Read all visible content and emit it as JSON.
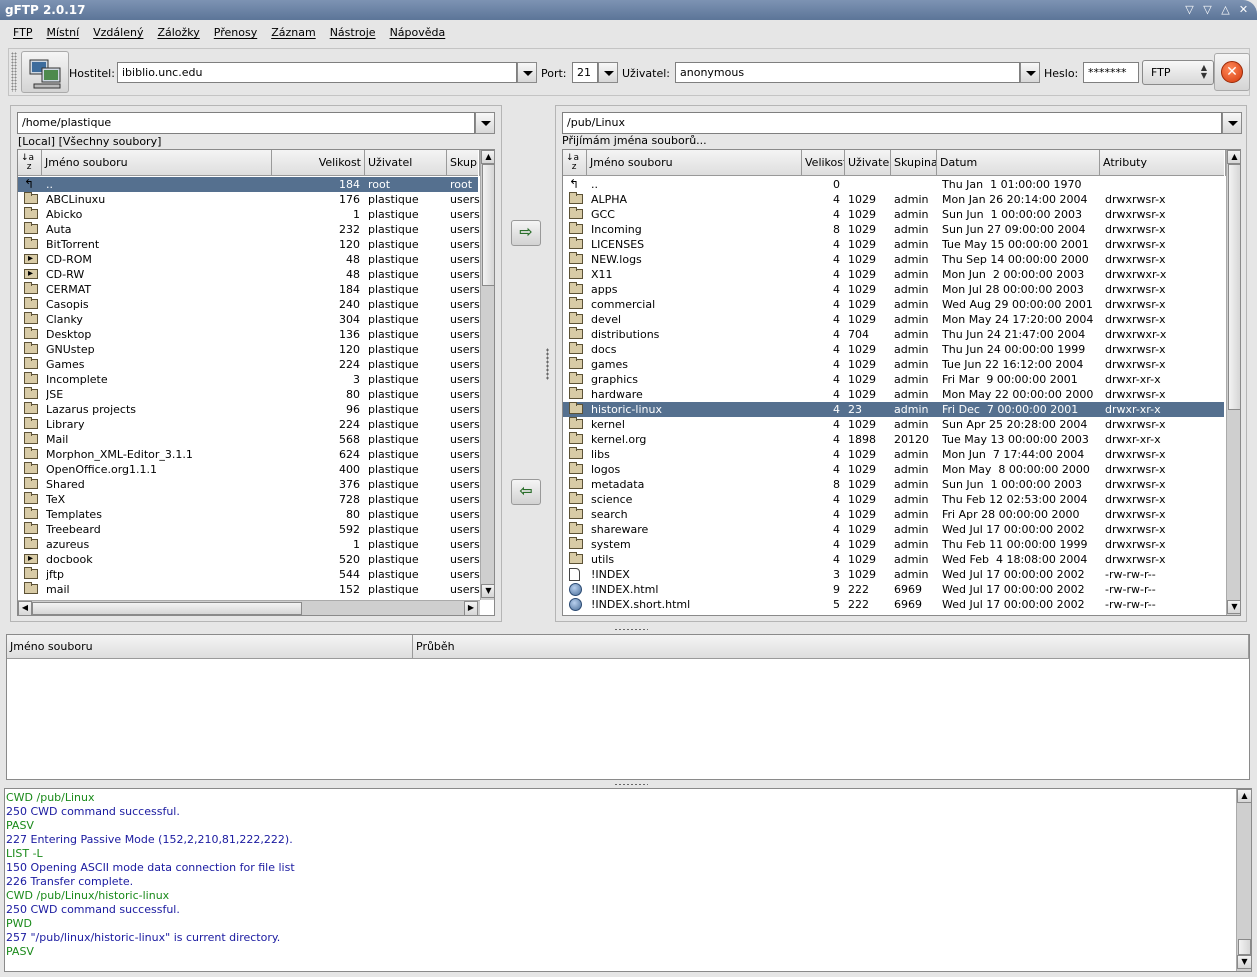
{
  "window": {
    "title": "gFTP 2.0.17"
  },
  "menu": [
    "FTP",
    "Místní",
    "Vzdálený",
    "Záložky",
    "Přenosy",
    "Záznam",
    "Nástroje",
    "Nápověda"
  ],
  "toolbar": {
    "host_label": "Hostitel:",
    "host_value": "ibiblio.unc.edu",
    "port_label": "Port:",
    "port_value": "21",
    "user_label": "Uživatel:",
    "user_value": "anonymous",
    "password_label": "Heslo:",
    "password_value": "*******",
    "protocol": "FTP"
  },
  "local": {
    "path": "/home/plastique",
    "status": "[Local] [Všechny soubory]",
    "columns": [
      "Jméno souboru",
      "Velikost",
      "Uživatel",
      "Skup"
    ],
    "files": [
      {
        "icon": "up",
        "name": "..",
        "size": "184",
        "user": "root",
        "group": "root",
        "selected": true
      },
      {
        "icon": "folder",
        "name": "ABCLinuxu",
        "size": "176",
        "user": "plastique",
        "group": "users"
      },
      {
        "icon": "folder",
        "name": "Abicko",
        "size": "1",
        "user": "plastique",
        "group": "users"
      },
      {
        "icon": "folder",
        "name": "Auta",
        "size": "232",
        "user": "plastique",
        "group": "users"
      },
      {
        "icon": "folder",
        "name": "BitTorrent",
        "size": "120",
        "user": "plastique",
        "group": "users"
      },
      {
        "icon": "link",
        "name": "CD-ROM",
        "size": "48",
        "user": "plastique",
        "group": "users"
      },
      {
        "icon": "link",
        "name": "CD-RW",
        "size": "48",
        "user": "plastique",
        "group": "users"
      },
      {
        "icon": "folder",
        "name": "CERMAT",
        "size": "184",
        "user": "plastique",
        "group": "users"
      },
      {
        "icon": "folder",
        "name": "Casopis",
        "size": "240",
        "user": "plastique",
        "group": "users"
      },
      {
        "icon": "folder",
        "name": "Clanky",
        "size": "304",
        "user": "plastique",
        "group": "users"
      },
      {
        "icon": "folder",
        "name": "Desktop",
        "size": "136",
        "user": "plastique",
        "group": "users"
      },
      {
        "icon": "folder",
        "name": "GNUstep",
        "size": "120",
        "user": "plastique",
        "group": "users"
      },
      {
        "icon": "folder",
        "name": "Games",
        "size": "224",
        "user": "plastique",
        "group": "users"
      },
      {
        "icon": "folder",
        "name": "Incomplete",
        "size": "3",
        "user": "plastique",
        "group": "users"
      },
      {
        "icon": "folder",
        "name": "JSE",
        "size": "80",
        "user": "plastique",
        "group": "users"
      },
      {
        "icon": "folder",
        "name": "Lazarus projects",
        "size": "96",
        "user": "plastique",
        "group": "users"
      },
      {
        "icon": "folder",
        "name": "Library",
        "size": "224",
        "user": "plastique",
        "group": "users"
      },
      {
        "icon": "folder",
        "name": "Mail",
        "size": "568",
        "user": "plastique",
        "group": "users"
      },
      {
        "icon": "folder",
        "name": "Morphon_XML-Editor_3.1.1",
        "size": "624",
        "user": "plastique",
        "group": "users"
      },
      {
        "icon": "folder",
        "name": "OpenOffice.org1.1.1",
        "size": "400",
        "user": "plastique",
        "group": "users"
      },
      {
        "icon": "folder",
        "name": "Shared",
        "size": "376",
        "user": "plastique",
        "group": "users"
      },
      {
        "icon": "folder",
        "name": "TeX",
        "size": "728",
        "user": "plastique",
        "group": "users"
      },
      {
        "icon": "folder",
        "name": "Templates",
        "size": "80",
        "user": "plastique",
        "group": "users"
      },
      {
        "icon": "folder",
        "name": "Treebeard",
        "size": "592",
        "user": "plastique",
        "group": "users"
      },
      {
        "icon": "folder",
        "name": "azureus",
        "size": "1",
        "user": "plastique",
        "group": "users"
      },
      {
        "icon": "link",
        "name": "docbook",
        "size": "520",
        "user": "plastique",
        "group": "users"
      },
      {
        "icon": "folder",
        "name": "jftp",
        "size": "544",
        "user": "plastique",
        "group": "users"
      },
      {
        "icon": "folder",
        "name": "mail",
        "size": "152",
        "user": "plastique",
        "group": "users"
      }
    ]
  },
  "remote": {
    "path": "/pub/Linux",
    "status": "Přijímám jména souborů...",
    "columns": [
      "Jméno souboru",
      "Velikost",
      "Uživatel",
      "Skupina",
      "Datum",
      "Atributy"
    ],
    "files": [
      {
        "icon": "up",
        "name": "..",
        "size": "0",
        "user": "",
        "group": "",
        "date": "Thu Jan  1 01:00:00 1970",
        "attr": ""
      },
      {
        "icon": "folder",
        "name": "ALPHA",
        "size": "4",
        "user": "1029",
        "group": "admin",
        "date": "Mon Jan 26 20:14:00 2004",
        "attr": "drwxrwsr-x"
      },
      {
        "icon": "folder",
        "name": "GCC",
        "size": "4",
        "user": "1029",
        "group": "admin",
        "date": "Sun Jun  1 00:00:00 2003",
        "attr": "drwxrwsr-x"
      },
      {
        "icon": "folder",
        "name": "Incoming",
        "size": "8",
        "user": "1029",
        "group": "admin",
        "date": "Sun Jun 27 09:00:00 2004",
        "attr": "drwxrwsr-x"
      },
      {
        "icon": "folder",
        "name": "LICENSES",
        "size": "4",
        "user": "1029",
        "group": "admin",
        "date": "Tue May 15 00:00:00 2001",
        "attr": "drwxrwsr-x"
      },
      {
        "icon": "folder",
        "name": "NEW.logs",
        "size": "4",
        "user": "1029",
        "group": "admin",
        "date": "Thu Sep 14 00:00:00 2000",
        "attr": "drwxrwsr-x"
      },
      {
        "icon": "folder",
        "name": "X11",
        "size": "4",
        "user": "1029",
        "group": "admin",
        "date": "Mon Jun  2 00:00:00 2003",
        "attr": "drwxrwxr-x"
      },
      {
        "icon": "folder",
        "name": "apps",
        "size": "4",
        "user": "1029",
        "group": "admin",
        "date": "Mon Jul 28 00:00:00 2003",
        "attr": "drwxrwsr-x"
      },
      {
        "icon": "folder",
        "name": "commercial",
        "size": "4",
        "user": "1029",
        "group": "admin",
        "date": "Wed Aug 29 00:00:00 2001",
        "attr": "drwxrwsr-x"
      },
      {
        "icon": "folder",
        "name": "devel",
        "size": "4",
        "user": "1029",
        "group": "admin",
        "date": "Mon May 24 17:20:00 2004",
        "attr": "drwxrwsr-x"
      },
      {
        "icon": "folder",
        "name": "distributions",
        "size": "4",
        "user": "704",
        "group": "admin",
        "date": "Thu Jun 24 21:47:00 2004",
        "attr": "drwxrwxr-x"
      },
      {
        "icon": "folder",
        "name": "docs",
        "size": "4",
        "user": "1029",
        "group": "admin",
        "date": "Thu Jun 24 00:00:00 1999",
        "attr": "drwxrwsr-x"
      },
      {
        "icon": "folder",
        "name": "games",
        "size": "4",
        "user": "1029",
        "group": "admin",
        "date": "Tue Jun 22 16:12:00 2004",
        "attr": "drwxrwsr-x"
      },
      {
        "icon": "folder",
        "name": "graphics",
        "size": "4",
        "user": "1029",
        "group": "admin",
        "date": "Fri Mar  9 00:00:00 2001",
        "attr": "drwxr-xr-x"
      },
      {
        "icon": "folder",
        "name": "hardware",
        "size": "4",
        "user": "1029",
        "group": "admin",
        "date": "Mon May 22 00:00:00 2000",
        "attr": "drwxrwsr-x"
      },
      {
        "icon": "folder",
        "name": "historic-linux",
        "size": "4",
        "user": "23",
        "group": "admin",
        "date": "Fri Dec  7 00:00:00 2001",
        "attr": "drwxr-xr-x",
        "selected": true
      },
      {
        "icon": "folder",
        "name": "kernel",
        "size": "4",
        "user": "1029",
        "group": "admin",
        "date": "Sun Apr 25 20:28:00 2004",
        "attr": "drwxrwsr-x"
      },
      {
        "icon": "folder",
        "name": "kernel.org",
        "size": "4",
        "user": "1898",
        "group": "20120",
        "date": "Tue May 13 00:00:00 2003",
        "attr": "drwxr-xr-x"
      },
      {
        "icon": "folder",
        "name": "libs",
        "size": "4",
        "user": "1029",
        "group": "admin",
        "date": "Mon Jun  7 17:44:00 2004",
        "attr": "drwxrwsr-x"
      },
      {
        "icon": "folder",
        "name": "logos",
        "size": "4",
        "user": "1029",
        "group": "admin",
        "date": "Mon May  8 00:00:00 2000",
        "attr": "drwxrwsr-x"
      },
      {
        "icon": "folder",
        "name": "metadata",
        "size": "8",
        "user": "1029",
        "group": "admin",
        "date": "Sun Jun  1 00:00:00 2003",
        "attr": "drwxrwsr-x"
      },
      {
        "icon": "folder",
        "name": "science",
        "size": "4",
        "user": "1029",
        "group": "admin",
        "date": "Thu Feb 12 02:53:00 2004",
        "attr": "drwxrwsr-x"
      },
      {
        "icon": "folder",
        "name": "search",
        "size": "4",
        "user": "1029",
        "group": "admin",
        "date": "Fri Apr 28 00:00:00 2000",
        "attr": "drwxrwsr-x"
      },
      {
        "icon": "folder",
        "name": "shareware",
        "size": "4",
        "user": "1029",
        "group": "admin",
        "date": "Wed Jul 17 00:00:00 2002",
        "attr": "drwxrwsr-x"
      },
      {
        "icon": "folder",
        "name": "system",
        "size": "4",
        "user": "1029",
        "group": "admin",
        "date": "Thu Feb 11 00:00:00 1999",
        "attr": "drwxrwsr-x"
      },
      {
        "icon": "folder",
        "name": "utils",
        "size": "4",
        "user": "1029",
        "group": "admin",
        "date": "Wed Feb  4 18:08:00 2004",
        "attr": "drwxrwsr-x"
      },
      {
        "icon": "doc",
        "name": "!INDEX",
        "size": "3",
        "user": "1029",
        "group": "admin",
        "date": "Wed Jul 17 00:00:00 2002",
        "attr": "-rw-rw-r--"
      },
      {
        "icon": "globe",
        "name": "!INDEX.html",
        "size": "9",
        "user": "222",
        "group": "6969",
        "date": "Wed Jul 17 00:00:00 2002",
        "attr": "-rw-rw-r--"
      },
      {
        "icon": "globe",
        "name": "!INDEX.short.html",
        "size": "5",
        "user": "222",
        "group": "6969",
        "date": "Wed Jul 17 00:00:00 2002",
        "attr": "-rw-rw-r--"
      }
    ]
  },
  "queue": {
    "columns": [
      "Jméno souboru",
      "Průběh"
    ]
  },
  "log": [
    {
      "type": "cmd",
      "text": "CWD /pub/Linux"
    },
    {
      "type": "resp",
      "text": "250 CWD command successful."
    },
    {
      "type": "cmd",
      "text": "PASV"
    },
    {
      "type": "resp",
      "text": "227 Entering Passive Mode (152,2,210,81,222,222)."
    },
    {
      "type": "cmd",
      "text": "LIST -L"
    },
    {
      "type": "resp",
      "text": "150 Opening ASCII mode data connection for file list"
    },
    {
      "type": "resp",
      "text": "226 Transfer complete."
    },
    {
      "type": "cmd",
      "text": "CWD /pub/Linux/historic-linux"
    },
    {
      "type": "resp",
      "text": "250 CWD command successful."
    },
    {
      "type": "cmd",
      "text": "PWD"
    },
    {
      "type": "resp",
      "text": "257 \"/pub/linux/historic-linux\" is current directory."
    },
    {
      "type": "cmd",
      "text": "PASV"
    }
  ],
  "icons": {
    "connect": "computers-connect-icon",
    "disconnect": "disconnect-icon",
    "upload": "arrow-right-icon",
    "download": "arrow-left-icon",
    "sort": "sort-az-icon"
  }
}
